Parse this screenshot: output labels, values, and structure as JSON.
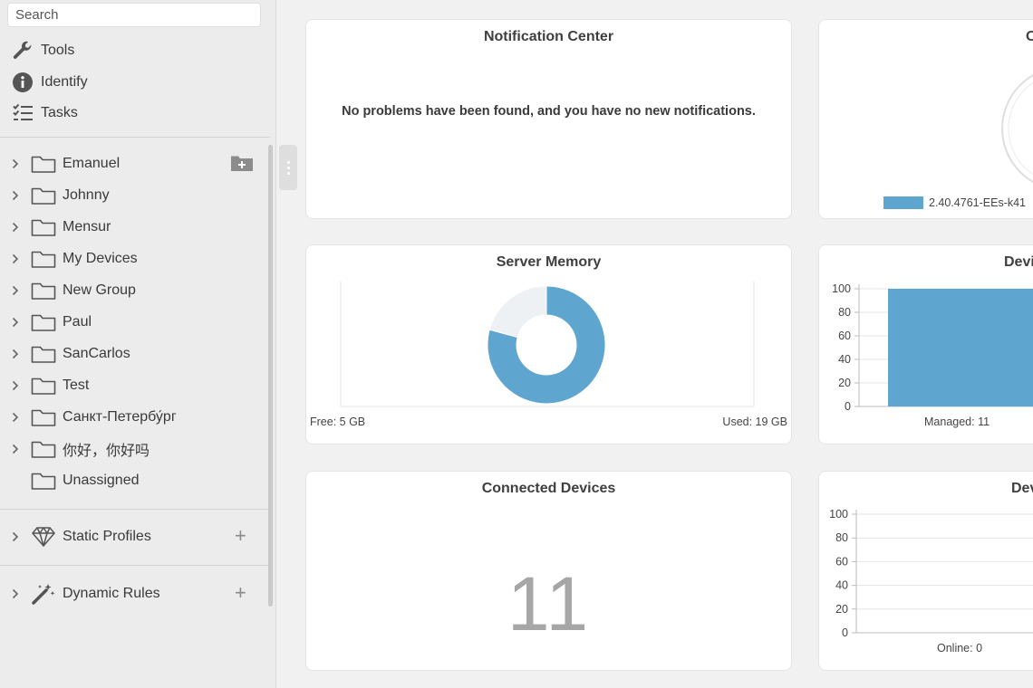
{
  "search": {
    "placeholder": "Search",
    "value": ""
  },
  "tools": [
    {
      "label": "Tools",
      "icon": "wrench-icon"
    },
    {
      "label": "Identify",
      "icon": "info-icon"
    },
    {
      "label": "Tasks",
      "icon": "tasks-icon"
    }
  ],
  "groups": [
    "Emanuel",
    "Johnny",
    "Mensur",
    "My Devices",
    "New Group",
    "Paul",
    "SanCarlos",
    "Test",
    "Санкт-Петербу́рг",
    "你好，你好吗",
    "Unassigned"
  ],
  "sections": {
    "static_profiles": {
      "label": "Static Profiles",
      "icon": "diamond-icon",
      "add": "+"
    },
    "dynamic_rules": {
      "label": "Dynamic Rules",
      "icon": "magic-wand-icon",
      "add": "+"
    }
  },
  "cards": {
    "notification_center": {
      "title": "Notification Center",
      "message": "No problems have been found, and you have no new notifications."
    },
    "os_versions": {
      "title": "O",
      "legend_label": "2.40.4761-EEs-k41"
    },
    "server_memory": {
      "title": "Server Memory",
      "free_label": "Free: 5 GB",
      "used_label": "Used: 19 GB"
    },
    "devices_managed": {
      "title": "Devi",
      "x_label": "Managed: 11"
    },
    "connected_devices": {
      "title": "Connected Devices",
      "count": "11"
    },
    "devices_online": {
      "title": "Dev",
      "x_label": "Online: 0"
    }
  },
  "colors": {
    "accent": "#5ea5cf",
    "sidebar_bg": "#ececec",
    "page_bg": "#f1f1f2"
  },
  "chart_data": [
    {
      "type": "pie",
      "title": "Server Memory",
      "donut": true,
      "slices": [
        {
          "label": "Used",
          "value": 19,
          "color": "#5ea5cf"
        },
        {
          "label": "Free",
          "value": 5,
          "color": "#eef1f4"
        }
      ]
    },
    {
      "type": "bar",
      "title": "Devi",
      "categories": [
        "Managed: 11"
      ],
      "values": [
        100
      ],
      "ylim": [
        0,
        100
      ],
      "yticks": [
        0,
        20,
        40,
        60,
        80,
        100
      ],
      "color": "#5ea5cf"
    },
    {
      "type": "bar",
      "title": "Dev",
      "categories": [
        "Online: 0"
      ],
      "values": [
        0
      ],
      "ylim": [
        0,
        100
      ],
      "yticks": [
        0,
        20,
        40,
        60,
        80,
        100
      ]
    }
  ]
}
